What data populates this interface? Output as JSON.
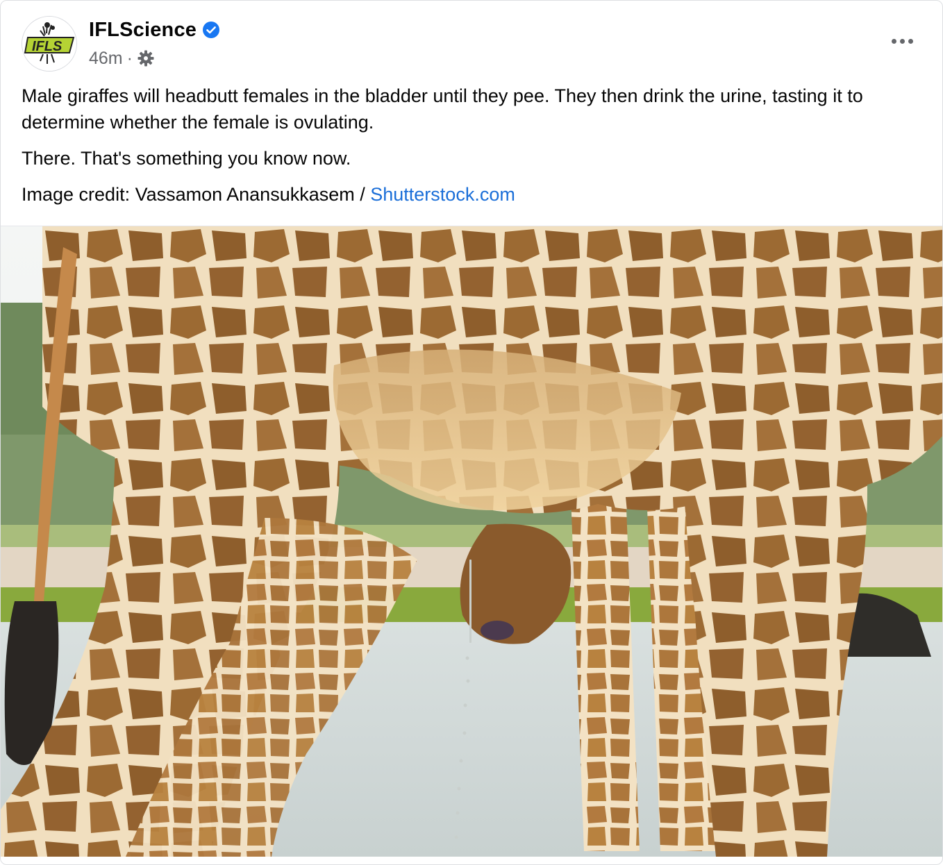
{
  "post": {
    "page_name": "IFLScience",
    "avatar_text": "IFLS",
    "timestamp": "46m",
    "separator": "·",
    "verified_icon": "verified-badge-icon",
    "audience_icon": "gear-icon",
    "more_icon": "more-horizontal-icon",
    "paragraphs": [
      "Male giraffes will headbutt females in the bladder until they pee. They then drink the urine, tasting it to determine whether the female is ovulating.",
      "There. That's something you know now."
    ],
    "credit_prefix": "Image credit: Vassamon Anansukkasem / ",
    "credit_link": "Shutterstock.com"
  },
  "colors": {
    "link": "#1a6ed8",
    "verified": "#1877f2",
    "meta_text": "#65676b",
    "avatar_accent": "#b5d334"
  }
}
